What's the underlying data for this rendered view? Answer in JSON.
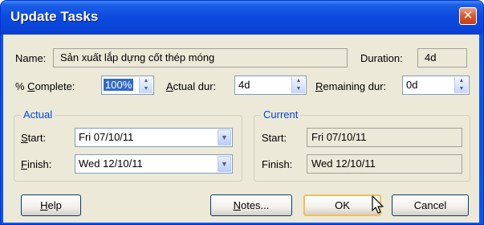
{
  "window": {
    "title": "Update Tasks",
    "close_glyph": "✕"
  },
  "task": {
    "name_label": "Name:",
    "name_value": "Sản xuất lắp dựng cốt thép móng",
    "duration_label": "Duration:",
    "duration_value": "4d"
  },
  "progress": {
    "percent_label_pre": "% ",
    "percent_label_u": "C",
    "percent_label_post": "omplete:",
    "percent_value": "100%",
    "actual_dur_label_u": "A",
    "actual_dur_label_post": "ctual dur:",
    "actual_dur_value": "4d",
    "remaining_label_u": "R",
    "remaining_label_post": "emaining dur:",
    "remaining_value": "0d"
  },
  "actual_group": {
    "title": "Actual",
    "start_label_u": "S",
    "start_label_post": "tart:",
    "start_value": "Fri 07/10/11",
    "finish_label_u": "F",
    "finish_label_post": "inish:",
    "finish_value": "Wed 12/10/11"
  },
  "current_group": {
    "title": "Current",
    "start_label": "Start:",
    "start_value": "Fri 07/10/11",
    "finish_label": "Finish:",
    "finish_value": "Wed 12/10/11"
  },
  "buttons": {
    "help_u": "H",
    "help_post": "elp",
    "notes_u": "N",
    "notes_post": "otes...",
    "ok": "OK",
    "cancel": "Cancel"
  },
  "colors": {
    "titlebar": "#0a47db",
    "dialog_bg": "#ece9d8",
    "group_title": "#0046d5",
    "default_button_border": "#f0c05c"
  }
}
